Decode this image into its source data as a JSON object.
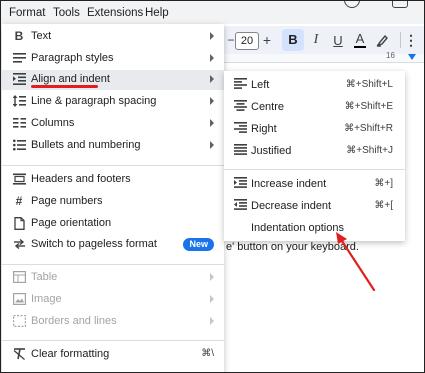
{
  "menubar": {
    "items": [
      "Format",
      "Tools",
      "Extensions",
      "Help"
    ]
  },
  "toolbar": {
    "minus": "−",
    "font_size": "20",
    "plus": "+",
    "bold": "B",
    "italic": "I",
    "underline": "U",
    "text_color": "A",
    "ruler_mark": "16"
  },
  "document": {
    "text_fragment": "e' button on your keyboard."
  },
  "format_menu": {
    "items": [
      {
        "label": "Text",
        "icon": "bold-icon"
      },
      {
        "label": "Paragraph styles",
        "icon": "paragraph-styles-icon"
      },
      {
        "label": "Align and indent",
        "icon": "align-indent-icon"
      },
      {
        "label": "Line & paragraph spacing",
        "icon": "line-spacing-icon"
      },
      {
        "label": "Columns",
        "icon": "columns-icon"
      },
      {
        "label": "Bullets and numbering",
        "icon": "bullets-icon"
      },
      {
        "label": "Headers and footers",
        "icon": "headers-footers-icon"
      },
      {
        "label": "Page numbers",
        "icon": "page-numbers-icon"
      },
      {
        "label": "Page orientation",
        "icon": "page-orientation-icon"
      },
      {
        "label": "Switch to pageless format",
        "icon": "pageless-icon",
        "badge": "New"
      },
      {
        "label": "Table",
        "icon": "table-icon"
      },
      {
        "label": "Image",
        "icon": "image-icon"
      },
      {
        "label": "Borders and lines",
        "icon": "borders-icon"
      },
      {
        "label": "Clear formatting",
        "icon": "clear-formatting-icon",
        "shortcut": "⌘\\"
      }
    ]
  },
  "align_submenu": {
    "items": [
      {
        "label": "Left",
        "shortcut": "⌘+Shift+L"
      },
      {
        "label": "Centre",
        "shortcut": "⌘+Shift+E"
      },
      {
        "label": "Right",
        "shortcut": "⌘+Shift+R"
      },
      {
        "label": "Justified",
        "shortcut": "⌘+Shift+J"
      },
      {
        "label": "Increase indent",
        "shortcut": "⌘+]"
      },
      {
        "label": "Decrease indent",
        "shortcut": "⌘+["
      },
      {
        "label": "Indentation options"
      }
    ]
  },
  "colors": {
    "badge": "#1a73e8",
    "annotation": "#e02020",
    "bold_active": "#d3e3fd"
  }
}
